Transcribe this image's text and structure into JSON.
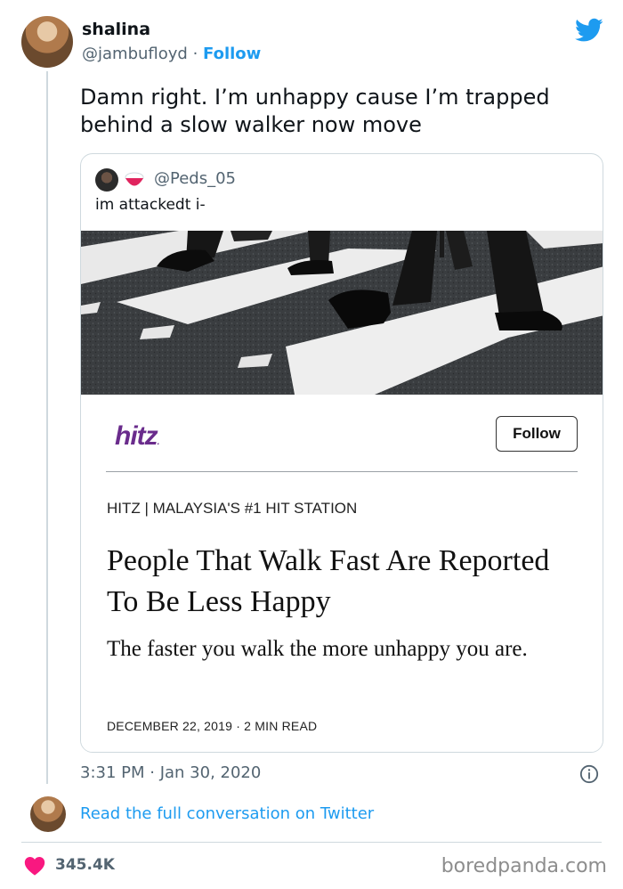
{
  "tweet": {
    "author_name": "shalina",
    "author_handle": "@jambufloyd",
    "separator": "·",
    "follow_label": "Follow",
    "text": "Damn right. I’m unhappy cause I’m trapped behind a slow walker now move",
    "timestamp": "3:31 PM · Jan 30, 2020",
    "likes": "345.4K",
    "read_more": "Read the full conversation on Twitter"
  },
  "quoted": {
    "handle": "@Peds_05",
    "text": "im attackedt i-",
    "article": {
      "logo": "hitz",
      "follow_label": "Follow",
      "station": "HITZ | MALAYSIA'S #1 HIT STATION",
      "headline": "People That Walk Fast Are Reported To Be Less Happy",
      "subhead": "The faster you walk the more unhappy you are.",
      "meta": "DECEMBER 22, 2019 · 2 MIN READ"
    }
  },
  "watermark": "boredpanda.com",
  "colors": {
    "accent": "#1d9bf0",
    "heart": "#f91880",
    "hitz_purple": "#6a2c8c"
  },
  "icons": [
    "twitter-bird-icon",
    "info-icon",
    "heart-icon"
  ]
}
